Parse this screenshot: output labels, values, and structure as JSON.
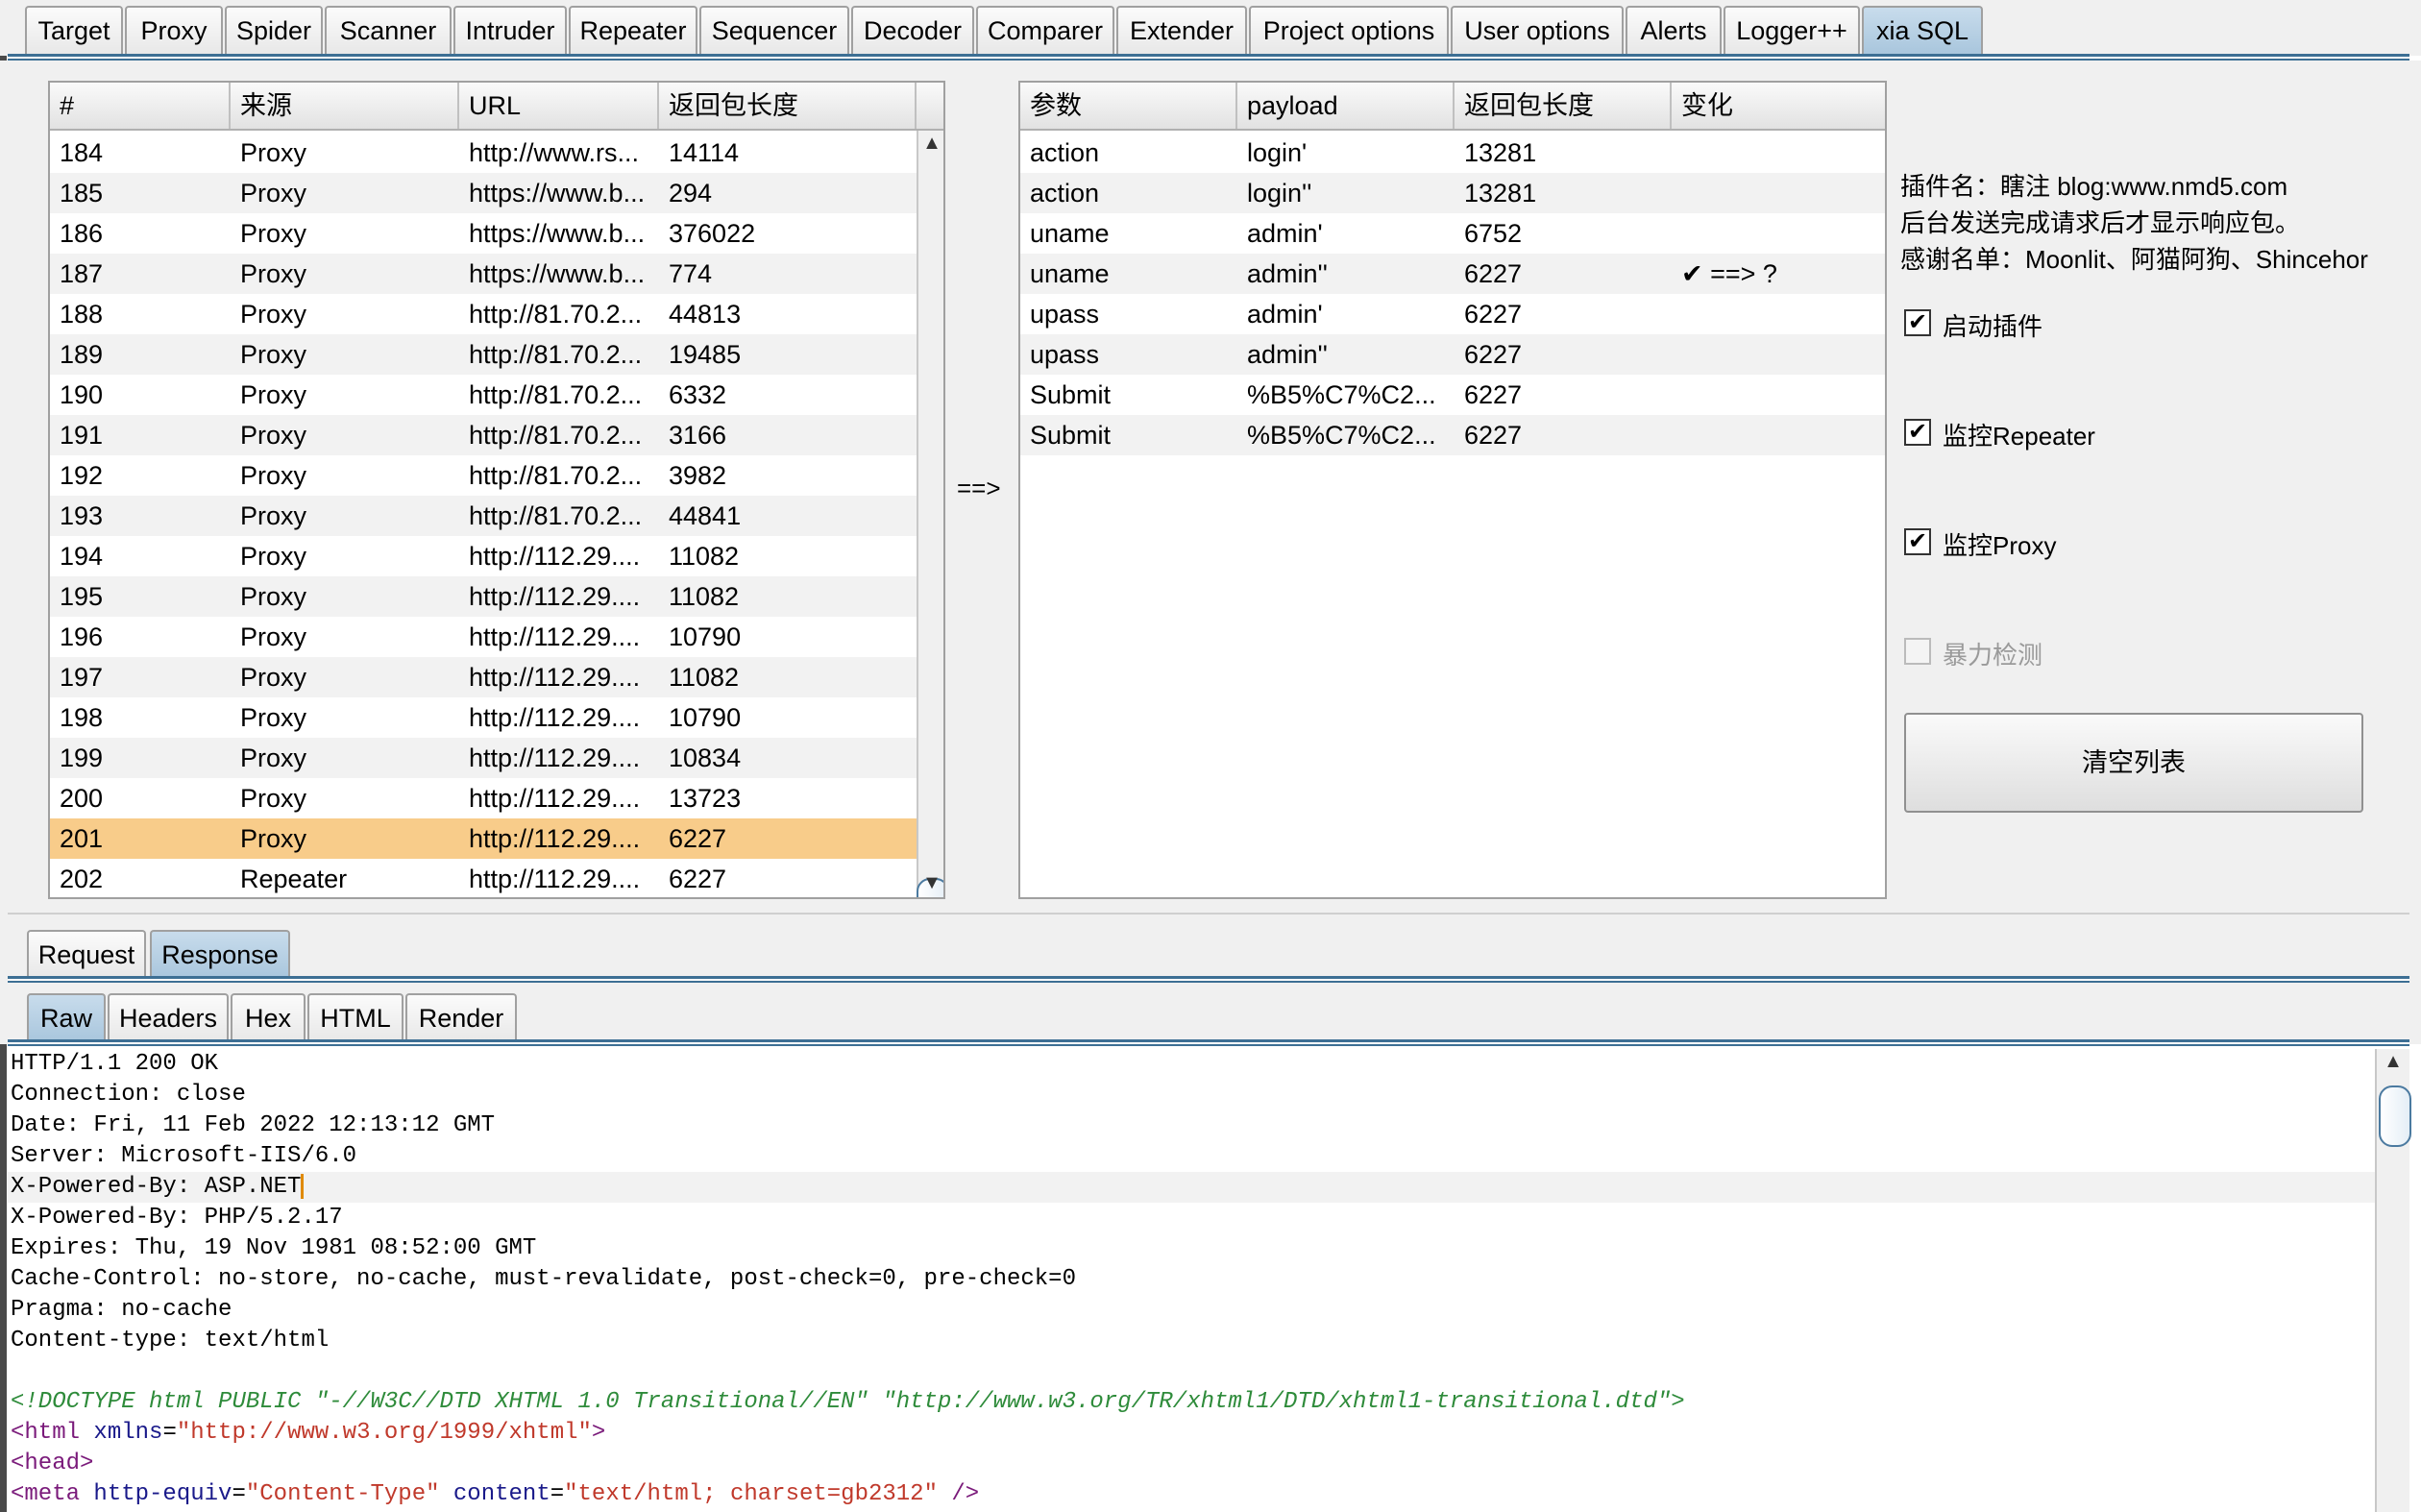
{
  "top_tabs": [
    "Target",
    "Proxy",
    "Spider",
    "Scanner",
    "Intruder",
    "Repeater",
    "Sequencer",
    "Decoder",
    "Comparer",
    "Extender",
    "Project options",
    "User options",
    "Alerts",
    "Logger++",
    "xia SQL"
  ],
  "history_table": {
    "headers": [
      "#",
      "来源",
      "URL",
      "返回包长度"
    ],
    "rows": [
      [
        "184",
        "Proxy",
        "http://www.rs...",
        "14114"
      ],
      [
        "185",
        "Proxy",
        "https://www.b...",
        "294"
      ],
      [
        "186",
        "Proxy",
        "https://www.b...",
        "376022"
      ],
      [
        "187",
        "Proxy",
        "https://www.b...",
        "774"
      ],
      [
        "188",
        "Proxy",
        "http://81.70.2...",
        "44813"
      ],
      [
        "189",
        "Proxy",
        "http://81.70.2...",
        "19485"
      ],
      [
        "190",
        "Proxy",
        "http://81.70.2...",
        "6332"
      ],
      [
        "191",
        "Proxy",
        "http://81.70.2...",
        "3166"
      ],
      [
        "192",
        "Proxy",
        "http://81.70.2...",
        "3982"
      ],
      [
        "193",
        "Proxy",
        "http://81.70.2...",
        "44841"
      ],
      [
        "194",
        "Proxy",
        "http://112.29....",
        "11082"
      ],
      [
        "195",
        "Proxy",
        "http://112.29....",
        "11082"
      ],
      [
        "196",
        "Proxy",
        "http://112.29....",
        "10790"
      ],
      [
        "197",
        "Proxy",
        "http://112.29....",
        "11082"
      ],
      [
        "198",
        "Proxy",
        "http://112.29....",
        "10790"
      ],
      [
        "199",
        "Proxy",
        "http://112.29....",
        "10834"
      ],
      [
        "200",
        "Proxy",
        "http://112.29....",
        "13723"
      ],
      [
        "201",
        "Proxy",
        "http://112.29....",
        "6227"
      ],
      [
        "202",
        "Repeater",
        "http://112.29....",
        "6227"
      ]
    ],
    "selected_row": "201"
  },
  "arrow_label": "==>",
  "payload_table": {
    "headers": [
      "参数",
      "payload",
      "返回包长度",
      "变化"
    ],
    "rows": [
      [
        "action",
        "login'",
        "13281",
        ""
      ],
      [
        "action",
        "login''",
        "13281",
        ""
      ],
      [
        "uname",
        "admin'",
        "6752",
        ""
      ],
      [
        "uname",
        "admin''",
        "6227",
        "✔ ==> ?"
      ],
      [
        "upass",
        "admin'",
        "6227",
        ""
      ],
      [
        "upass",
        "admin''",
        "6227",
        ""
      ],
      [
        "Submit",
        "%B5%C7%C2...",
        "6227",
        ""
      ],
      [
        "Submit",
        "%B5%C7%C2...",
        "6227",
        ""
      ]
    ]
  },
  "plugin_info": {
    "name_line": "插件名：瞎注 blog:www.nmd5.com",
    "note_line": "后台发送完成请求后才显示响应包。",
    "thanks_line": "感谢名单：Moonlit、阿猫阿狗、Shincehor"
  },
  "options": [
    {
      "label": "启动插件",
      "checked": true,
      "enabled": true
    },
    {
      "label": "监控Repeater",
      "checked": true,
      "enabled": true
    },
    {
      "label": "监控Proxy",
      "checked": true,
      "enabled": true
    },
    {
      "label": "暴力检测",
      "checked": false,
      "enabled": false
    }
  ],
  "clear_button": "清空列表",
  "message_tabs": [
    "Request",
    "Response"
  ],
  "view_tabs": [
    "Raw",
    "Headers",
    "Hex",
    "HTML",
    "Render"
  ],
  "response_lines": [
    "HTTP/1.1 200 OK",
    "Connection: close",
    "Date: Fri, 11 Feb 2022 12:13:12 GMT",
    "Server: Microsoft-IIS/6.0",
    "X-Powered-By: ASP.NET",
    "X-Powered-By: PHP/5.2.17",
    "Expires: Thu, 19 Nov 1981 08:52:00 GMT",
    "Cache-Control: no-store, no-cache, must-revalidate, post-check=0, pre-check=0",
    "Pragma: no-cache",
    "Content-type: text/html",
    ""
  ],
  "html_lines": {
    "doctype": "<!DOCTYPE html PUBLIC \"-//W3C//DTD XHTML 1.0 Transitional//EN\" \"http://www.w3.org/TR/xhtml1/DTD/xhtml1-transitional.dtd\">",
    "html_open": "<html",
    "html_attr": " xmlns",
    "html_eq": "=",
    "html_val": "\"http://www.w3.org/1999/xhtml\"",
    "html_close": ">",
    "head": "<head>",
    "meta_open": "<meta",
    "meta_attr1": " http-equiv",
    "meta_val1": "\"Content-Type\"",
    "meta_attr2": " content",
    "meta_val2": "\"text/html; charset=gb2312\"",
    "meta_close": " />"
  }
}
